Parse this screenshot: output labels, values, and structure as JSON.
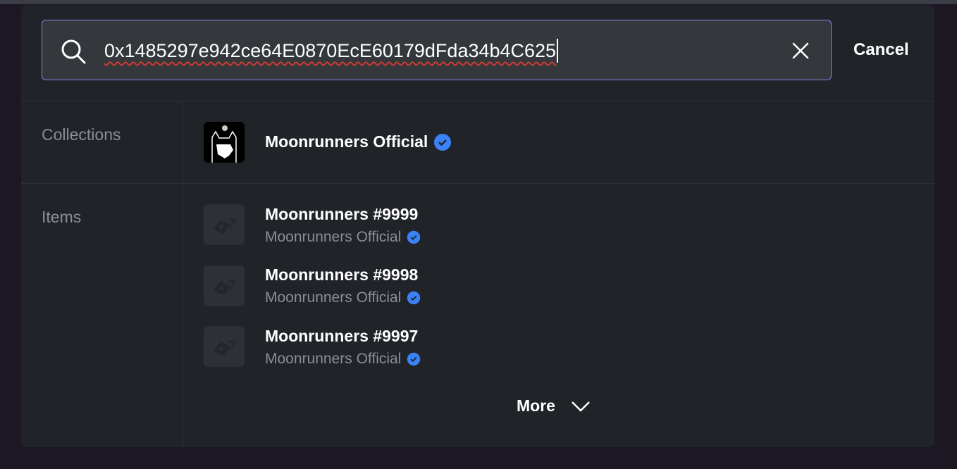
{
  "search": {
    "query": "0x1485297e942ce64E0870EcE60179dFda34b4C625",
    "cancel_label": "Cancel"
  },
  "sections": {
    "collections_label": "Collections",
    "items_label": "Items"
  },
  "collections": [
    {
      "name": "Moonrunners Official",
      "verified": true
    }
  ],
  "items": [
    {
      "name": "Moonrunners #9999",
      "collection": "Moonrunners Official",
      "verified": true
    },
    {
      "name": "Moonrunners #9998",
      "collection": "Moonrunners Official",
      "verified": true
    },
    {
      "name": "Moonrunners #9997",
      "collection": "Moonrunners Official",
      "verified": true
    }
  ],
  "more_label": "More",
  "colors": {
    "accent": "#9a7ae6",
    "verified": "#3b82f6",
    "background": "#202327"
  }
}
